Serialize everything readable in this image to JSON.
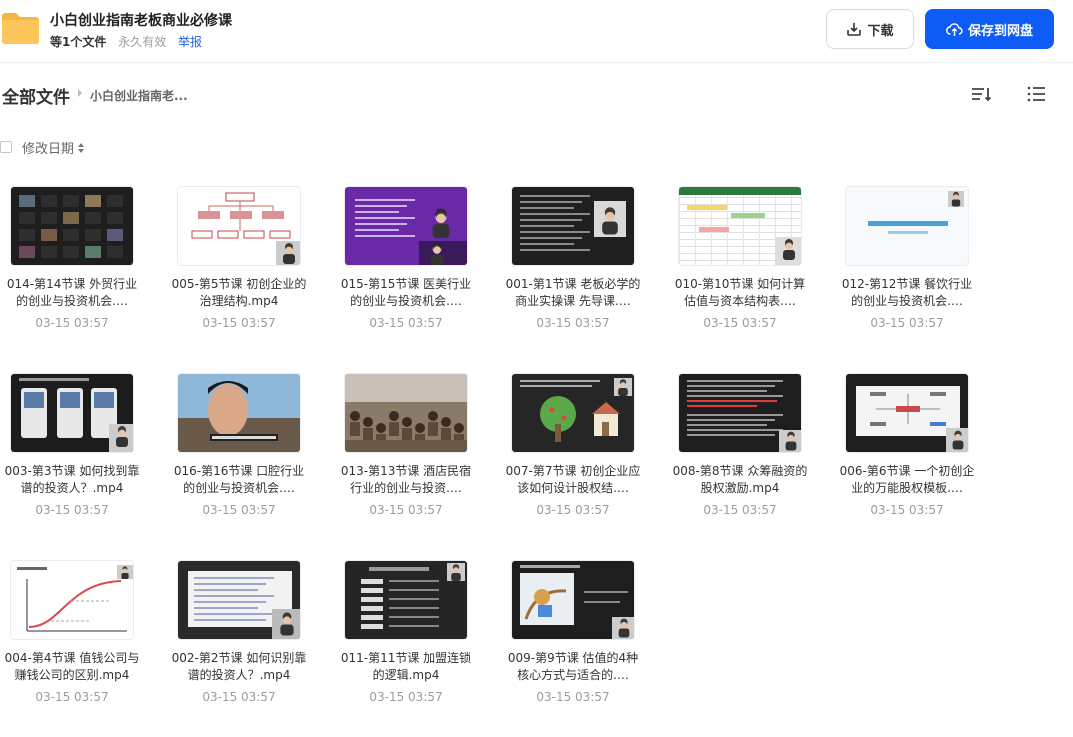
{
  "share": {
    "title": "小白创业指南老板商业必修课",
    "file_count": "等1个文件",
    "validity": "永久有效",
    "report": "举报"
  },
  "actions": {
    "download_label": "下载",
    "save_label": "保存到网盘"
  },
  "breadcrumb": {
    "root": "全部文件",
    "current": "小白创业指南老..."
  },
  "toolbar": {
    "date_sort_label": "修改日期"
  },
  "colors": {
    "accent": "#0d5cf5",
    "folder": "#fcc65a",
    "link": "#2460ea"
  },
  "files": [
    {
      "name": "014-第14节课 外贸行业的创业与投资机会.…",
      "date": "03-15 03:57",
      "thumb": "dark-grid"
    },
    {
      "name": "005-第5节课 初创企业的治理结构.mp4",
      "date": "03-15 03:57",
      "thumb": "org-chart"
    },
    {
      "name": "015-第15节课 医美行业的创业与投资机会.…",
      "date": "03-15 03:57",
      "thumb": "purple-presenter"
    },
    {
      "name": "001-第1节课 老板必学的商业实操课 先导课.…",
      "date": "03-15 03:57",
      "thumb": "dark-text-speaker"
    },
    {
      "name": "010-第10节课 如何计算估值与资本结构表.…",
      "date": "03-15 03:57",
      "thumb": "spreadsheet"
    },
    {
      "name": "012-第12节课 餐饮行业的创业与投资机会.…",
      "date": "03-15 03:57",
      "thumb": "white-title"
    },
    {
      "name": "003-第3节课 如何找到靠谱的投资人？.mp4",
      "date": "03-15 03:57",
      "thumb": "dark-phones"
    },
    {
      "name": "016-第16节课 口腔行业的创业与投资机会.…",
      "date": "03-15 03:57",
      "thumb": "face-closeup"
    },
    {
      "name": "013-第13节课 酒店民宿行业的创业与投资.…",
      "date": "03-15 03:57",
      "thumb": "room-photo"
    },
    {
      "name": "007-第7节课 初创企业应该如何设计股权结.…",
      "date": "03-15 03:57",
      "thumb": "tree-house"
    },
    {
      "name": "008-第8节课 众筹融资的股权激励.mp4",
      "date": "03-15 03:57",
      "thumb": "dark-red-text"
    },
    {
      "name": "006-第6节课 一个初创企业的万能股权模板.…",
      "date": "03-15 03:57",
      "thumb": "dark-mindmap"
    },
    {
      "name": "004-第4节课 值钱公司与赚钱公司的区别.mp4",
      "date": "03-15 03:57",
      "thumb": "white-curve"
    },
    {
      "name": "002-第2节课 如何识别靠谱的投资人？.mp4",
      "date": "03-15 03:57",
      "thumb": "dark-doc"
    },
    {
      "name": "011-第11节课 加盟连锁的逻辑.mp4",
      "date": "03-15 03:57",
      "thumb": "dark-list"
    },
    {
      "name": "009-第9节课 估值的4种核心方式与适合的.…",
      "date": "03-15 03:57",
      "thumb": "dark-illustration"
    }
  ]
}
